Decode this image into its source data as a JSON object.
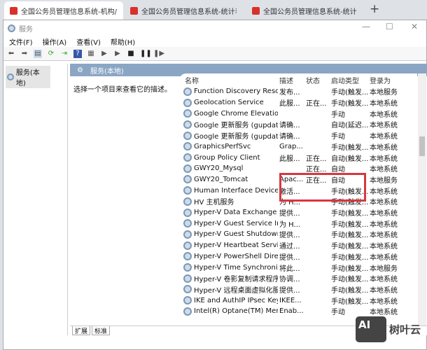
{
  "browser_tabs": [
    {
      "title": "全国公务员管理信息系统-机构/"
    },
    {
      "title": "全国公务员管理信息系统-统计表"
    },
    {
      "title": "全国公务员管理信息系统-统计"
    }
  ],
  "window_title": "服务",
  "menu": [
    "文件(F)",
    "操作(A)",
    "查看(V)",
    "帮助(H)"
  ],
  "tree_item": "服务(本地)",
  "pane_title": "服务(本地)",
  "description_hint": "选择一个项目来查看它的描述。",
  "columns": [
    "名称",
    "描述",
    "状态",
    "启动类型",
    "登录为"
  ],
  "rows": [
    [
      "Function Discovery Resour...",
      "发布...",
      "",
      "手动(触发...",
      "本地服务"
    ],
    [
      "Geolocation Service",
      "此服...",
      "正在...",
      "手动(触发...",
      "本地系统"
    ],
    [
      "Google Chrome Elevation ...",
      "",
      "",
      "手动",
      "本地系统"
    ],
    [
      "Google 更新服务 (gupdate)",
      "请确...",
      "",
      "自动(延迟...",
      "本地系统"
    ],
    [
      "Google 更新服务 (gupdate...",
      "请确...",
      "",
      "手动",
      "本地系统"
    ],
    [
      "GraphicsPerfSvc",
      "Grap...",
      "",
      "手动(触发...",
      "本地系统"
    ],
    [
      "Group Policy Client",
      "此服...",
      "正在...",
      "自动(触发...",
      "本地系统"
    ],
    [
      "GWY20_Mysql",
      "",
      "正在...",
      "自动",
      "本地系统"
    ],
    [
      "GWY20_Tomcat",
      "Apac...",
      "正在...",
      "自动",
      "本地服务"
    ],
    [
      "Human Interface Device S...",
      "激活...",
      "",
      "手动(触发...",
      "本地系统"
    ],
    [
      "HV 主机服务",
      "为 H...",
      "",
      "手动(触发...",
      "本地系统"
    ],
    [
      "Hyper-V Data Exchange Se...",
      "提供...",
      "",
      "手动(触发...",
      "本地系统"
    ],
    [
      "Hyper-V Guest Service Int...",
      "为 H...",
      "",
      "手动(触发...",
      "本地系统"
    ],
    [
      "Hyper-V Guest Shutdown ...",
      "提供...",
      "",
      "手动(触发...",
      "本地系统"
    ],
    [
      "Hyper-V Heartbeat Service",
      "通过...",
      "",
      "手动(触发...",
      "本地系统"
    ],
    [
      "Hyper-V PowerShell Direct...",
      "提供...",
      "",
      "手动(触发...",
      "本地系统"
    ],
    [
      "Hyper-V Time Synchroniza...",
      "将此...",
      "",
      "手动(触发...",
      "本地服务"
    ],
    [
      "Hyper-V 卷影复制请求程序",
      "协调...",
      "",
      "手动(触发...",
      "本地系统"
    ],
    [
      "Hyper-V 远程桌面虚拟化服...",
      "提供...",
      "",
      "手动(触发...",
      "本地系统"
    ],
    [
      "IKE and AuthIP IPsec Keyin...",
      "IKEE...",
      "",
      "手动(触发...",
      "本地系统"
    ],
    [
      "Intel(R) Optane(TM) Mem...",
      "Enab...",
      "",
      "手动",
      "本地系统"
    ]
  ],
  "bottom_tabs": [
    "扩展",
    "标准"
  ],
  "watermark": {
    "logo": "AI",
    "text": "树叶云"
  }
}
